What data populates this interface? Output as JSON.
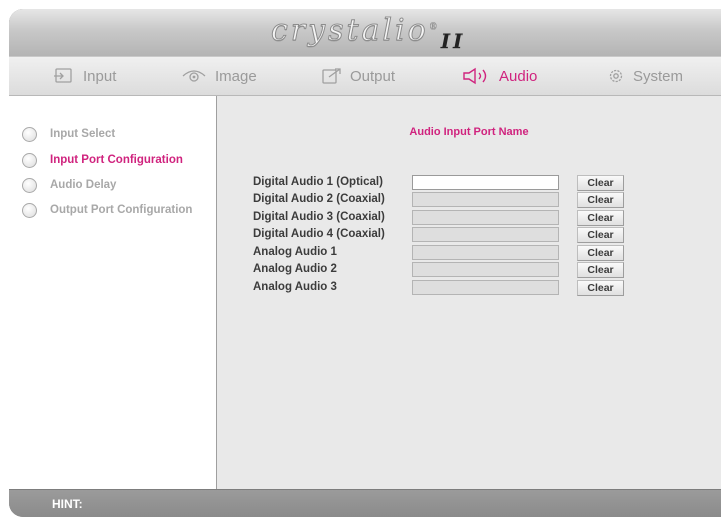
{
  "header": {
    "logo_text": "crystalio",
    "logo_suffix": "II",
    "logo_mark": "®"
  },
  "nav": {
    "tabs": [
      {
        "label": "Input",
        "icon": "input-icon",
        "active": false
      },
      {
        "label": "Image",
        "icon": "eye-icon",
        "active": false
      },
      {
        "label": "Output",
        "icon": "output-icon",
        "active": false
      },
      {
        "label": "Audio",
        "icon": "speaker-icon",
        "active": true
      },
      {
        "label": "System",
        "icon": "gear-icon",
        "active": false
      }
    ]
  },
  "sidebar": {
    "items": [
      {
        "label": "Input Select",
        "active": false
      },
      {
        "label": "Input Port Configuration",
        "active": true
      },
      {
        "label": "Audio Delay",
        "active": false
      },
      {
        "label": "Output Port Configuration",
        "active": false
      }
    ]
  },
  "main": {
    "title": "Audio Input Port Name",
    "clear_label": "Clear",
    "rows": [
      {
        "label": "Digital Audio 1 (Optical)",
        "value": "",
        "active": true
      },
      {
        "label": "Digital Audio 2 (Coaxial)",
        "value": "",
        "active": false
      },
      {
        "label": "Digital Audio 3 (Coaxial)",
        "value": "",
        "active": false
      },
      {
        "label": "Digital Audio 4 (Coaxial)",
        "value": "",
        "active": false
      },
      {
        "label": "Analog Audio 1",
        "value": "",
        "active": false
      },
      {
        "label": "Analog Audio 2",
        "value": "",
        "active": false
      },
      {
        "label": "Analog Audio 3",
        "value": "",
        "active": false
      }
    ]
  },
  "hint": {
    "label": "HINT:"
  },
  "colors": {
    "accent": "#d0237e",
    "panel": "#e9e9e9",
    "frame": "#a9a9a9"
  }
}
